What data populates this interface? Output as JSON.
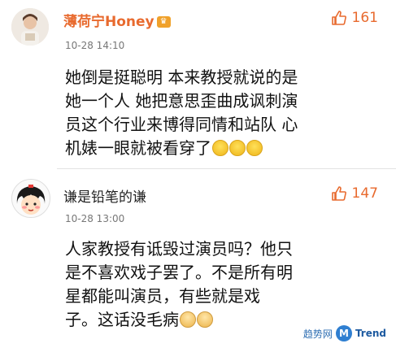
{
  "comments": [
    {
      "username": "薄荷宁Honey",
      "time": "10-28 14:10",
      "likes": "161",
      "lines": [
        "她倒是挺聪明 本来教授就说的是",
        "她一个人 她把意思歪曲成讽刺演",
        "员这个行业来博得同情和站队 心",
        "机婊一眼就被看穿了"
      ],
      "emoji_count": 3,
      "verified_badge": "vip-badge-icon"
    },
    {
      "username": "谦是铅笔的谦",
      "time": "10-28 13:00",
      "likes": "147",
      "lines": [
        "人家教授有诋毁过演员吗？他只",
        "是不喜欢戏子罢了。不是所有明",
        "星都能叫演员，有些就是戏",
        "子。这话没毛病"
      ],
      "emoji_count": 2
    }
  ],
  "watermark": {
    "site": "趋势网",
    "brand": "Trend",
    "mark": "M"
  },
  "colors": {
    "accent": "#e86a2e",
    "time": "#777777",
    "text": "#111111"
  }
}
